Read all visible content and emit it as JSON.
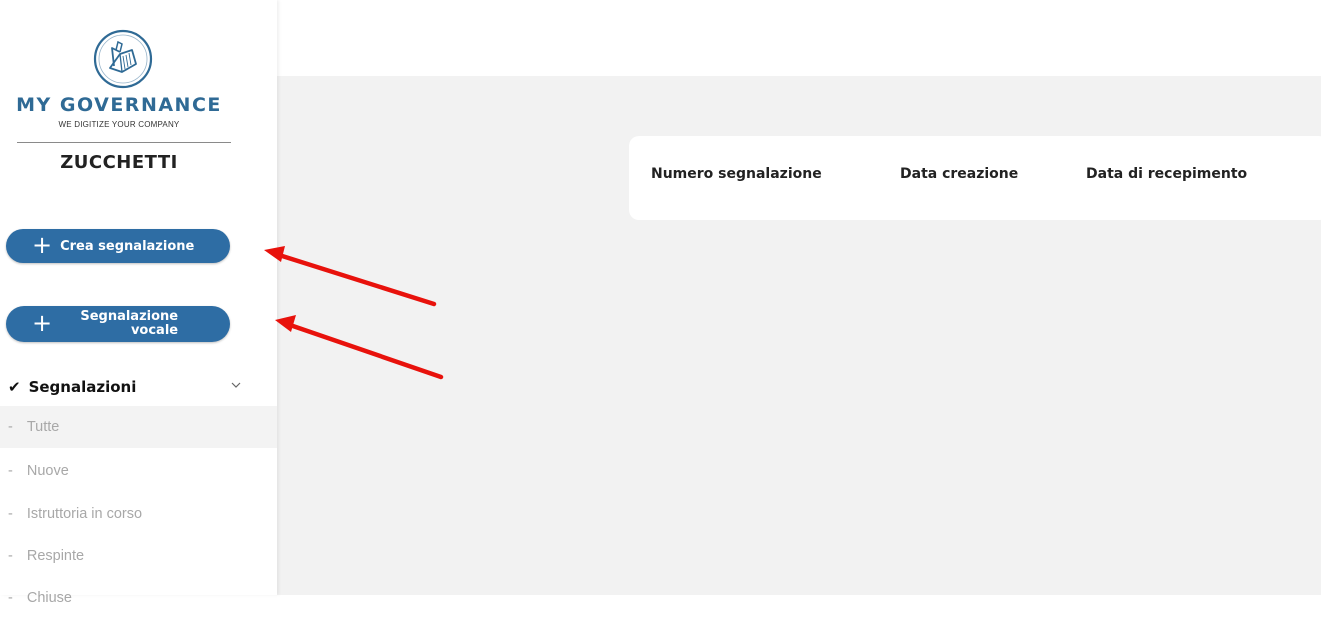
{
  "brand": {
    "name": "MY GOVERNANCE",
    "tagline": "WE DIGITIZE YOUR COMPANY",
    "company": "ZUCCHETTI",
    "accent_color": "#2f6a95",
    "icon": "book-logo-icon"
  },
  "buttons": {
    "create": {
      "icon": "plus-icon",
      "label": "Crea segnalazione"
    },
    "voice": {
      "icon": "plus-icon",
      "label": "Segnalazione\nvocale"
    },
    "color": "#2e6da4"
  },
  "nav": {
    "section": {
      "icon": "check-icon",
      "label": "Segnalazioni",
      "expand_icon": "chevron-down-icon"
    },
    "items": [
      {
        "dash": "-",
        "label": "Tutte",
        "active": true
      },
      {
        "dash": "-",
        "label": "Nuove"
      },
      {
        "dash": "-",
        "label": "Istruttoria in corso"
      },
      {
        "dash": "-",
        "label": "Respinte"
      },
      {
        "dash": "-",
        "label": "Chiuse"
      }
    ]
  },
  "table": {
    "columns": [
      "Numero segnalazione",
      "Data creazione",
      "Data di recepimento"
    ]
  },
  "annotations": {
    "arrow_color": "#e8120c"
  }
}
